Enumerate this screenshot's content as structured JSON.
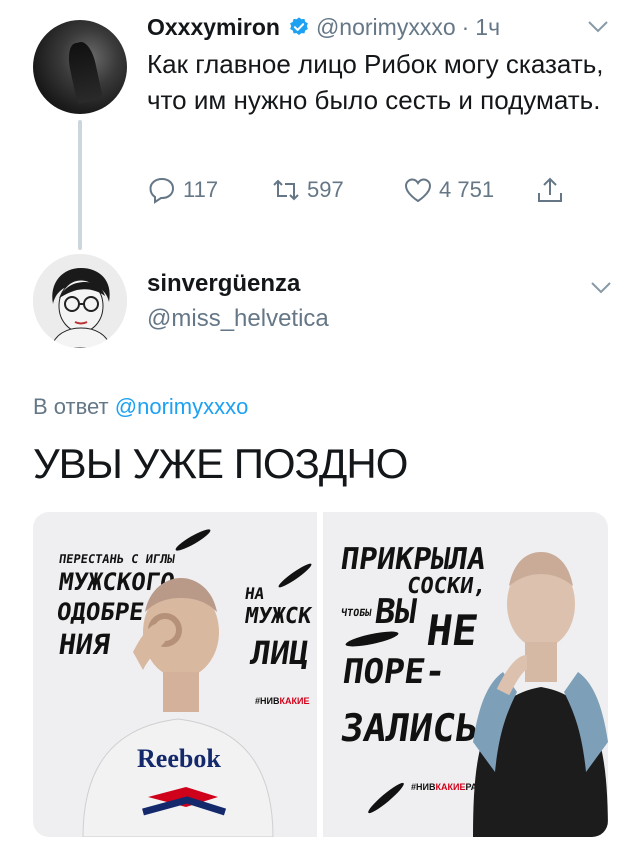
{
  "tweet1": {
    "name": "Oxxxymiron",
    "handle": "@norimyxxxo",
    "time": "1ч",
    "dot": "·",
    "text": "Как главное лицо Рибок могу сказать, что им нужно было сесть и подумать.",
    "reply_count": "117",
    "retweet_count": "597",
    "like_count": "4 751"
  },
  "tweet2": {
    "name": "sinvergüenza",
    "handle": "@miss_helvetica",
    "reply_prefix": "В ответ",
    "reply_handle": "@norimyxxxo",
    "text": "УВЫ УЖЕ ПОЗДНО"
  },
  "posters": {
    "left": {
      "line1": "ПЕРЕСТАНЬ С ИГЛЫ",
      "line2": "МУЖСКОГО",
      "line3": "ОДОБРЕ-",
      "line4": "НИЯ",
      "line5": "НА",
      "line6": "МУЖСК",
      "line7": "ЛИЦ",
      "hashtag_prefix": "#НИВ",
      "hashtag_red": "КАКИЕ",
      "shirt_logo": "Reebok"
    },
    "right": {
      "line1": "ПРИКРЫЛА",
      "line2": "СОСКИ,",
      "line3": "ЧТОБЫ",
      "line4": "ВЫ",
      "line5": "НЕ",
      "line6": "ПОРЕ-",
      "line7": "ЗАЛИСЬ",
      "hashtag_prefix": "#НИВ",
      "hashtag_red": "КАКИЕ",
      "hashtag_suffix": "РАМКИ"
    }
  },
  "colors": {
    "link": "#1da1f2",
    "secondary_text": "#657786",
    "primary_text": "#14171a",
    "verified": "#1da1f2",
    "thread_line": "#ccd6dd"
  }
}
